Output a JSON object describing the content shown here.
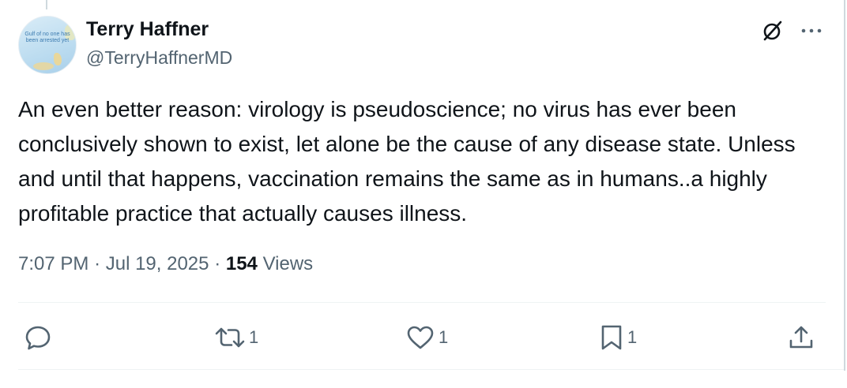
{
  "author": {
    "display_name": "Terry Haffner",
    "handle": "@TerryHaffnerMD",
    "avatar_text": "Gulf of no one has been arrested yet"
  },
  "tweet": {
    "text": "An even better reason: virology is pseudoscience; no virus has ever been conclusively shown to exist, let alone be the cause of any disease state. Unless and until that happens, vaccination remains the same as in humans..a highly profitable practice that actually causes illness."
  },
  "meta": {
    "time": "7:07 PM",
    "separator": "·",
    "date": "Jul 19, 2025",
    "views_count": "154",
    "views_label": "Views"
  },
  "actions": {
    "reply_count": "",
    "retweet_count": "1",
    "like_count": "1",
    "bookmark_count": "1"
  },
  "icons": {
    "header": [
      "grok-icon",
      "more-icon"
    ],
    "actions": [
      "reply-icon",
      "retweet-icon",
      "like-icon",
      "bookmark-icon",
      "share-icon"
    ]
  },
  "colors": {
    "text_primary": "#0f1419",
    "text_secondary": "#536471",
    "divider": "#eff3f4"
  }
}
